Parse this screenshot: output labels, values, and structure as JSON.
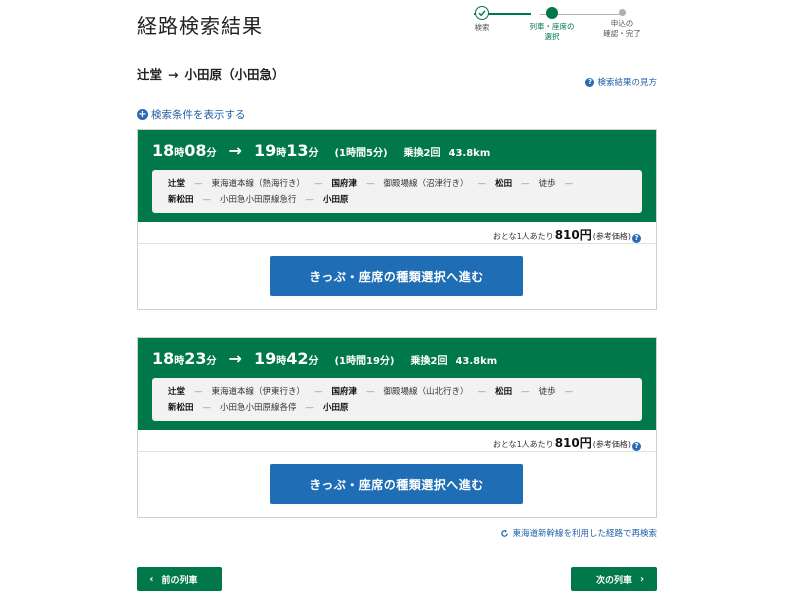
{
  "page_title": "経路検索結果",
  "stepper": {
    "steps": [
      {
        "label": "検索",
        "state": "done"
      },
      {
        "label": "列車・座席の\n選択",
        "label_1": "列車・座席の",
        "label_2": "選択",
        "state": "current"
      },
      {
        "label_1": "申込の",
        "label_2": "確認・完了",
        "state": "todo"
      }
    ]
  },
  "route": {
    "from": "辻堂",
    "arrow": "→",
    "to": "小田原（小田急）"
  },
  "help_link": "検索結果の見方",
  "conditions_link": "検索条件を表示する",
  "results": [
    {
      "dep_h": "18",
      "dep_m": "08",
      "arr_h": "19",
      "arr_m": "13",
      "hour_unit": "時",
      "min_unit": "分",
      "arrow": "→",
      "duration": "(1時間5分)",
      "transfers": "乗換2回",
      "distance": "43.8km",
      "line1": {
        "s1": "辻堂",
        "r1": "東海道本線（熱海行き）",
        "s2": "国府津",
        "r2": "御殿場線（沼津行き）",
        "s3": "松田",
        "r3": "徒歩"
      },
      "line2": {
        "s4": "新松田",
        "r4": "小田急小田原線急行",
        "s5": "小田原"
      },
      "price_prefix": "おとな1人あたり",
      "price": "810円",
      "price_suffix": "(参考価格)",
      "button": "きっぷ・座席の種類選択へ進む"
    },
    {
      "dep_h": "18",
      "dep_m": "23",
      "arr_h": "19",
      "arr_m": "42",
      "hour_unit": "時",
      "min_unit": "分",
      "arrow": "→",
      "duration": "(1時間19分)",
      "transfers": "乗換2回",
      "distance": "43.8km",
      "line1": {
        "s1": "辻堂",
        "r1": "東海道本線（伊東行き）",
        "s2": "国府津",
        "r2": "御殿場線（山北行き）",
        "s3": "松田",
        "r3": "徒歩"
      },
      "line2": {
        "s4": "新松田",
        "r4": "小田急小田原線各停",
        "s5": "小田原"
      },
      "price_prefix": "おとな1人あたり",
      "price": "810円",
      "price_suffix": "(参考価格)",
      "button": "きっぷ・座席の種類選択へ進む"
    }
  ],
  "research_link": "東海道新幹線を利用した経路で再検索",
  "nav": {
    "prev": "前の列車",
    "next": "次の列車"
  },
  "colors": {
    "brand_green": "#00784a",
    "button_blue": "#1f6db5",
    "link_blue": "#1f5fa8"
  },
  "icons": {
    "done": "check-icon",
    "help": "question-icon",
    "conditions": "plus-circle-icon",
    "research": "refresh-icon"
  }
}
